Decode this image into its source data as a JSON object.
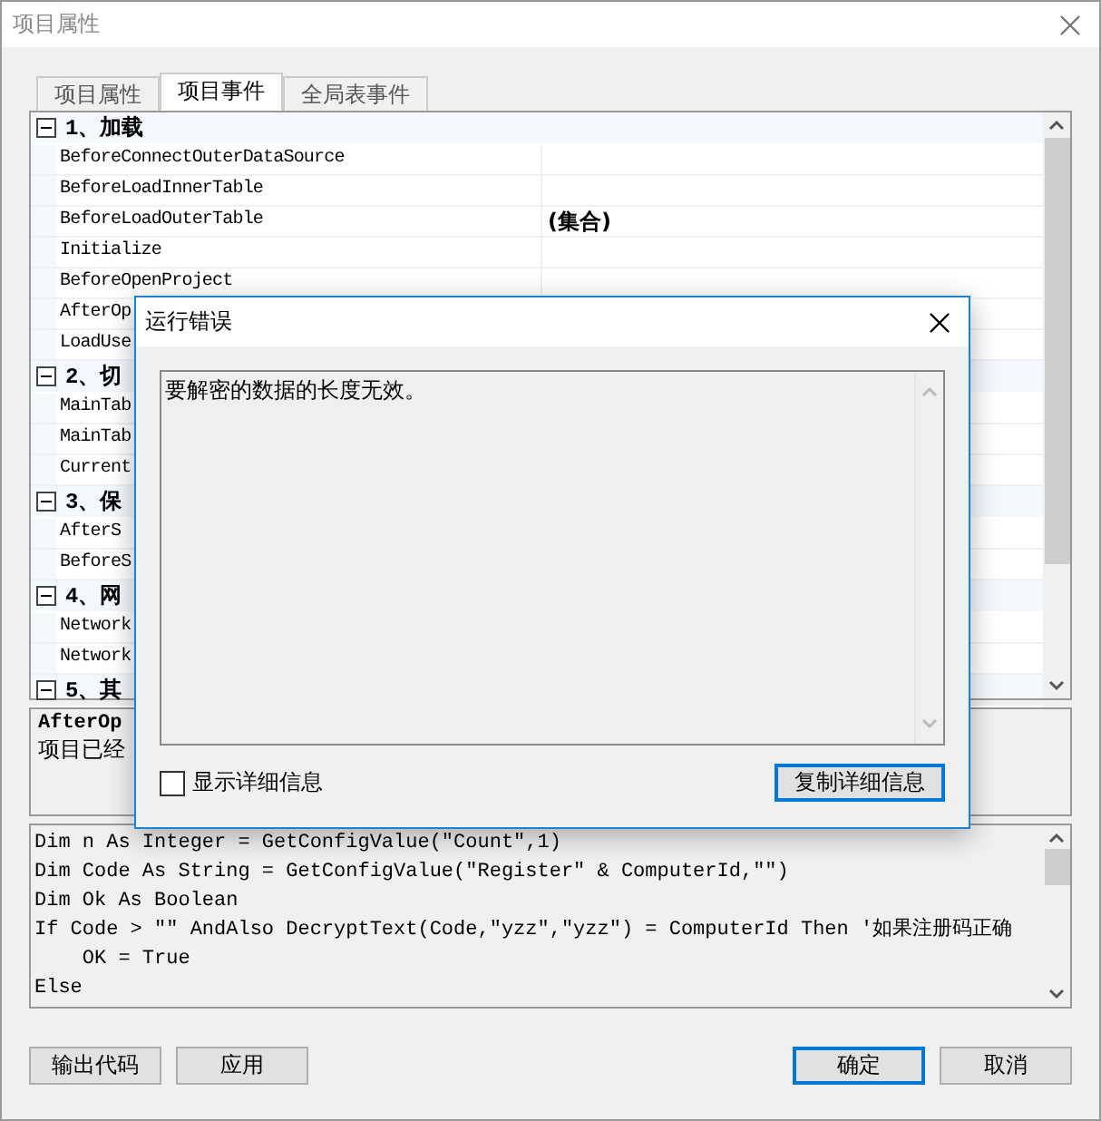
{
  "window": {
    "title": "项目属性"
  },
  "tabs": [
    {
      "label": "项目属性",
      "selected": false
    },
    {
      "label": "项目事件",
      "selected": true
    },
    {
      "label": "全局表事件",
      "selected": false
    }
  ],
  "property_grid": {
    "categories": [
      {
        "title": "1、加载",
        "expanded": true,
        "items": [
          {
            "name": "BeforeConnectOuterDataSource",
            "value": ""
          },
          {
            "name": "BeforeLoadInnerTable",
            "value": ""
          },
          {
            "name": "BeforeLoadOuterTable",
            "value": "(集合)"
          },
          {
            "name": "Initialize",
            "value": ""
          },
          {
            "name": "BeforeOpenProject",
            "value": ""
          },
          {
            "name": "AfterOp",
            "value": ""
          },
          {
            "name": "LoadUse",
            "value": ""
          }
        ]
      },
      {
        "title": "2、切",
        "expanded": true,
        "items": [
          {
            "name": "MainTab",
            "value": ""
          },
          {
            "name": "MainTab",
            "value": ""
          },
          {
            "name": "Current",
            "value": ""
          }
        ]
      },
      {
        "title": "3、保",
        "expanded": true,
        "items": [
          {
            "name": "AfterS",
            "value": ""
          },
          {
            "name": "BeforeS",
            "value": ""
          }
        ]
      },
      {
        "title": "4、网",
        "expanded": true,
        "items": [
          {
            "name": "Network",
            "value": ""
          },
          {
            "name": "Network",
            "value": ""
          }
        ]
      },
      {
        "title": "5、其",
        "expanded": true
      }
    ]
  },
  "description": {
    "title": "AfterOp",
    "text": "项目已经"
  },
  "code": [
    "Dim n As Integer = GetConfigValue(\"Count\",1)",
    "Dim Code As String = GetConfigValue(\"Register\" & ComputerId,\"\")",
    "Dim Ok As Boolean",
    "If Code > \"\" AndAlso DecryptText(Code,\"yzz\",\"yzz\") = ComputerId Then '如果注册码正确",
    "    OK = True",
    "Else"
  ],
  "buttons_left": [
    {
      "label": "输出代码",
      "default": false
    },
    {
      "label": "应用",
      "default": false
    }
  ],
  "buttons_right": [
    {
      "label": "确定",
      "default": true
    },
    {
      "label": "取消",
      "default": false
    }
  ],
  "error_dialog": {
    "title": "运行错误",
    "message": "要解密的数据的长度无效。",
    "show_details": {
      "label": "显示详细信息",
      "checked": false
    },
    "copy_button": {
      "label": "复制详细信息",
      "default": true
    }
  }
}
